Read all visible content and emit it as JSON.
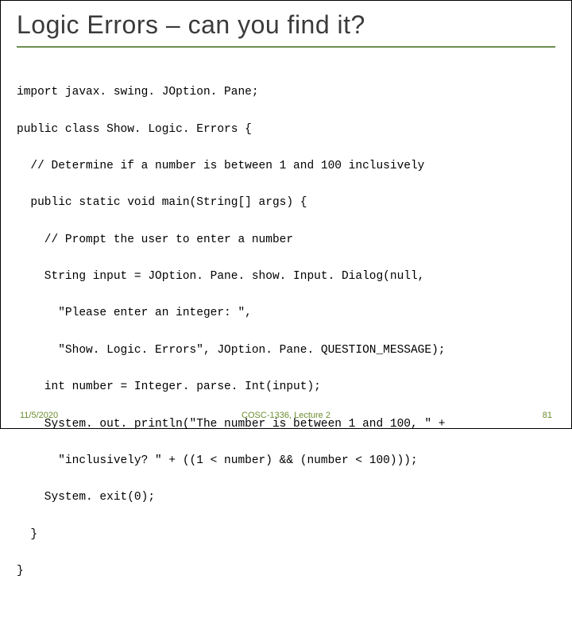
{
  "title": "Logic Errors  – can you find it?",
  "code": {
    "l1": "import javax. swing. JOption. Pane;",
    "l2": "public class Show. Logic. Errors {",
    "l3": "  // Determine if a number is between 1 and 100 inclusively",
    "l4": "  public static void main(String[] args) {",
    "l5": "    // Prompt the user to enter a number",
    "l6": "    String input = JOption. Pane. show. Input. Dialog(null,",
    "l7": "      \"Please enter an integer: \",",
    "l8": "      \"Show. Logic. Errors\", JOption. Pane. QUESTION_MESSAGE);",
    "l9": "    int number = Integer. parse. Int(input);",
    "l10": "    System. out. println(\"The number is between 1 and 100, \" +",
    "l11": "      \"inclusively? \" + ((1 < number) && (number < 100)));",
    "l12": "    System. exit(0);",
    "l13": "  }",
    "l14": "}"
  },
  "footer": {
    "date": "11/5/2020",
    "center": "COSC-1336, Lecture 2",
    "page": "81"
  }
}
